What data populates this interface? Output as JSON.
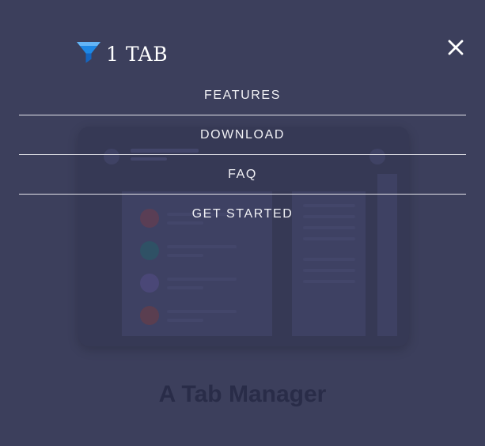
{
  "brand": {
    "name": "1 TAB",
    "icon": "funnel-icon"
  },
  "menu": {
    "close_icon": "close-icon",
    "items": [
      {
        "label": "FEATURES"
      },
      {
        "label": "DOWNLOAD"
      },
      {
        "label": "FAQ"
      },
      {
        "label": "GET STARTED"
      }
    ]
  },
  "hero": {
    "title": "A Tab Manager"
  },
  "colors": {
    "overlay_bg": "#3c3f5c",
    "brand_blue": "#1e88e5",
    "text": "#ffffff"
  }
}
